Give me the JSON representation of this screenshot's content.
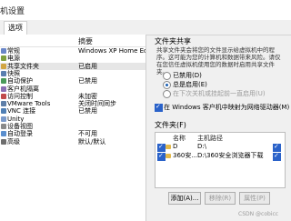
{
  "window": {
    "title": "机设置"
  },
  "tabs": [
    {
      "label": "选项"
    }
  ],
  "settings_list": {
    "headers": {
      "name": "",
      "summary": "摘要"
    },
    "rows": [
      {
        "name": "常规",
        "summary": "Windows XP Home Edition",
        "icon_color": "#6a86c7"
      },
      {
        "name": "电源",
        "summary": "",
        "icon_color": "#7f9f3f"
      },
      {
        "name": "共享文件夹",
        "summary": "已启用",
        "icon_color": "#d1a542"
      },
      {
        "name": "快照",
        "summary": "",
        "icon_color": "#5a7fb0"
      },
      {
        "name": "自动保护",
        "summary": "已禁用",
        "icon_color": "#4a9a5a"
      },
      {
        "name": "客户机隔离",
        "summary": "",
        "icon_color": "#8a6fb3"
      },
      {
        "name": "访问控制",
        "summary": "未加密",
        "icon_color": "#c14b4b"
      },
      {
        "name": "VMware Tools",
        "summary": "关闭时间同步",
        "icon_color": "#5e7fa8"
      },
      {
        "name": "VNC 连接",
        "summary": "已禁用",
        "icon_color": "#4f7fb5"
      },
      {
        "name": "Unity",
        "summary": "",
        "icon_color": "#7a9acb"
      },
      {
        "name": "设备视图",
        "summary": "",
        "icon_color": "#8a8a8a"
      },
      {
        "name": "自动登录",
        "summary": "不可用",
        "icon_color": "#5b8fce"
      },
      {
        "name": "高级",
        "summary": "默认/默认",
        "icon_color": "#6e6e6e"
      }
    ]
  },
  "folder_sharing": {
    "title": "文件夹共享",
    "description": "共享文件夹会将您的文件显示给虚拟机中的程序。这可能为您的计算机和数据带来风险。请仅在您信任虚拟机使用您的数据时启用共享文件夹。",
    "options": [
      {
        "label": "已禁用(D)",
        "selected": false,
        "disabled": false
      },
      {
        "label": "总是启用(E)",
        "selected": true,
        "disabled": false
      },
      {
        "label": "在下次关机或挂起前一直启用(U)",
        "selected": false,
        "disabled": true
      }
    ],
    "map_network_drive": {
      "label": "在 Windows 客户机中映射为网络驱动器(M)",
      "checked": true
    }
  },
  "folders": {
    "title": "文件夹(F)",
    "headers": {
      "name": "名称",
      "path": "主机路径"
    },
    "rows": [
      {
        "name": "D",
        "path": "D:\\",
        "checked": true,
        "enabled": true
      },
      {
        "name": "360安...",
        "path": "D:\\360安全浏览器下载",
        "checked": true,
        "enabled": true
      }
    ]
  },
  "buttons": {
    "add": "添加(A)...",
    "remove": "移除(R)",
    "properties": "属性(P)"
  },
  "watermark": "CSDN @cobicc"
}
